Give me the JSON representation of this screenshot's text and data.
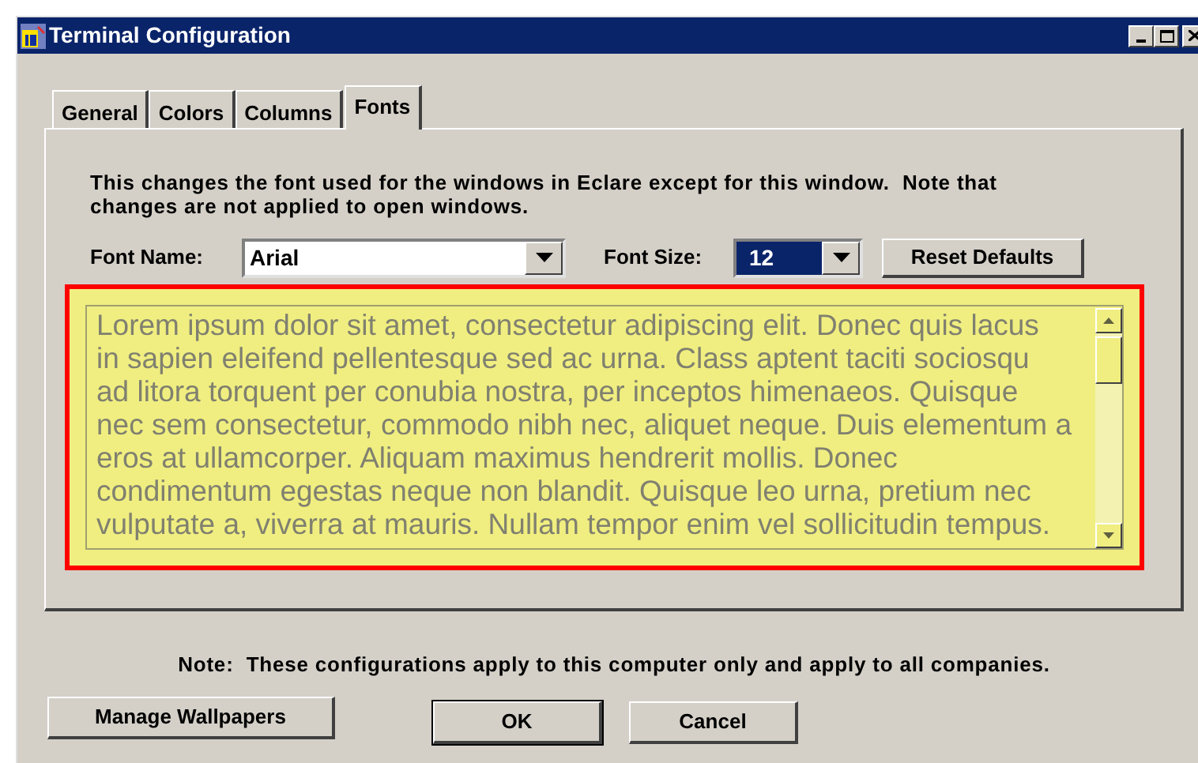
{
  "window": {
    "title": "Terminal Configuration"
  },
  "tabs": [
    {
      "label": "General",
      "selected": false
    },
    {
      "label": "Colors",
      "selected": false
    },
    {
      "label": "Columns",
      "selected": false
    },
    {
      "label": "Fonts",
      "selected": true
    }
  ],
  "description": [
    "This changes the font used for the windows in Eclare except for this window.  Note that",
    "changes are not applied to open windows."
  ],
  "font_name": {
    "label": "Font Name:",
    "value": "Arial"
  },
  "font_size": {
    "label": "Font Size:",
    "value": "12"
  },
  "reset_button": "Reset Defaults",
  "preview_lines": [
    "Lorem ipsum dolor sit amet, consectetur adipiscing elit. Donec quis lacus",
    "in sapien eleifend pellentesque sed ac urna. Class aptent taciti sociosqu",
    "ad litora torquent per conubia nostra, per inceptos himenaeos. Quisque",
    "nec sem consectetur, commodo nibh nec, aliquet neque. Duis elementum a",
    "eros at ullamcorper. Aliquam maximus hendrerit mollis. Donec",
    "condimentum egestas neque non blandit. Quisque leo urna, pretium nec",
    "vulputate a, viverra at mauris. Nullam tempor enim vel sollicitudin tempus."
  ],
  "note": "Note:  These configurations apply to this computer only and apply to all companies.",
  "buttons": [
    "Manage Wallpapers",
    "OK",
    "Cancel"
  ]
}
